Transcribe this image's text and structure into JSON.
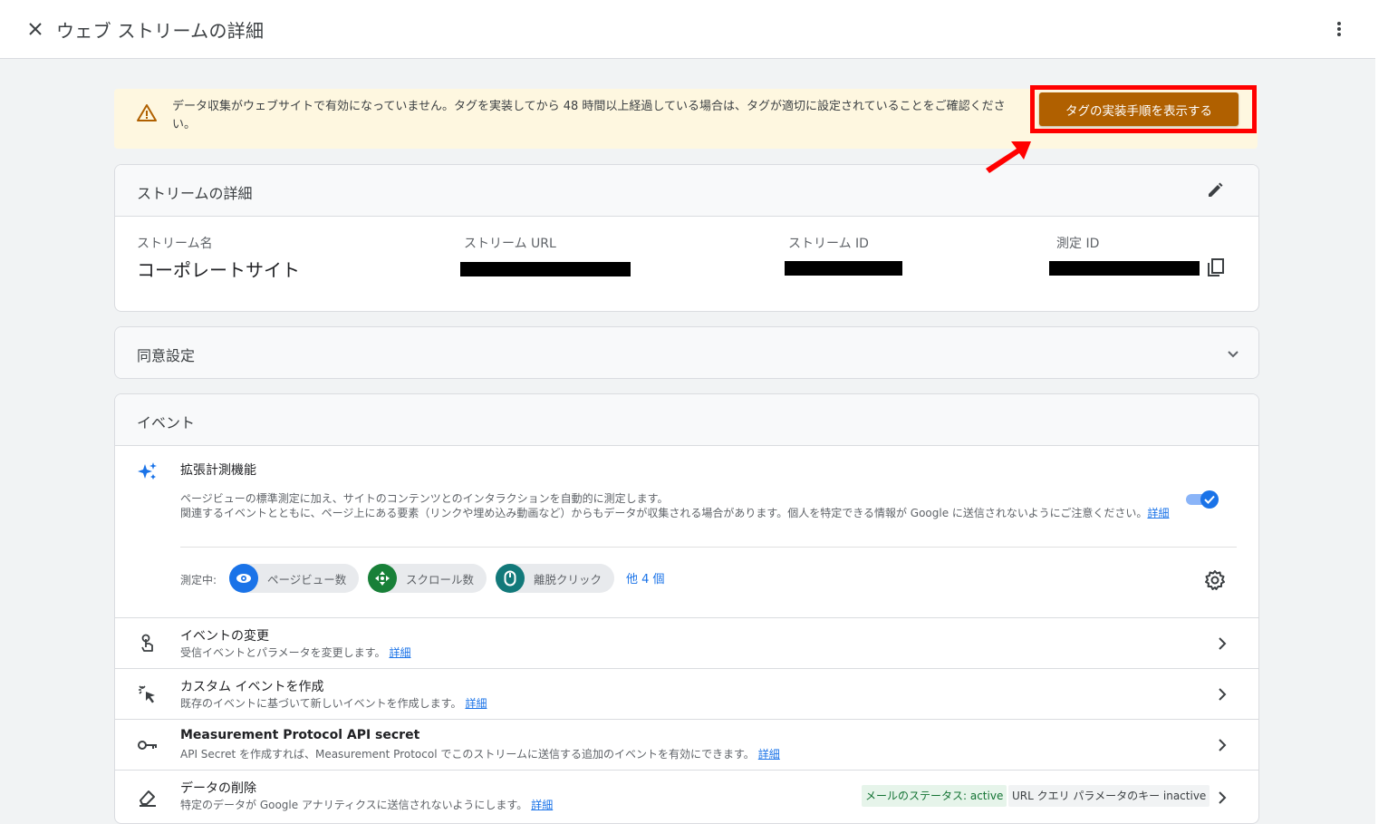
{
  "header": {
    "title": "ウェブ ストリームの詳細"
  },
  "banner": {
    "message": "データ収集がウェブサイトで有効になっていません。タグを実装してから 48 時間以上経過している場合は、タグが適切に設定されていることをご確認ください。",
    "button_label": "タグの実装手順を表示する",
    "accent_color": "#b06000",
    "annotation_color": "#ff0000"
  },
  "stream_details": {
    "title": "ストリームの詳細",
    "name_label": "ストリーム名",
    "name_value": "コーポレートサイト",
    "url_label": "ストリーム URL",
    "id_label": "ストリーム ID",
    "measurement_id_label": "測定 ID"
  },
  "consent": {
    "title": "同意設定"
  },
  "events": {
    "title": "イベント",
    "enhanced": {
      "title": "拡張計測機能",
      "desc_line1": "ページビューの標準測定に加え、サイトのコンテンツとのインタラクションを自動的に測定します。",
      "desc_line2": "関連するイベントとともに、ページ上にある要素（リンクや埋め込み動画など）からもデータが収集される場合があります。個人を特定できる情報が Google に送信されないようにご注意ください。",
      "desc_link": "詳細",
      "toggle_on": true,
      "measuring_label": "測定中:",
      "chips": [
        {
          "label": "ページビュー数",
          "icon": "eye-icon",
          "color": "#1a73e8"
        },
        {
          "label": "スクロール数",
          "icon": "scroll-icon",
          "color": "#188038"
        },
        {
          "label": "離脱クリック",
          "icon": "mouse-icon",
          "color": "#12797a"
        }
      ],
      "more_label": "他 4 個"
    },
    "rows": [
      {
        "title": "イベントの変更",
        "desc": "受信イベントとパラメータを変更します。",
        "link": "詳細",
        "icon": "touch-icon"
      },
      {
        "title": "カスタム イベントを作成",
        "desc": "既存のイベントに基づいて新しいイベントを作成します。",
        "link": "詳細",
        "icon": "sparkle-click-icon"
      },
      {
        "title": "Measurement Protocol API secret",
        "desc": "API Secret を作成すれば、Measurement Protocol でこのストリームに送信する追加のイベントを有効にできます。",
        "link": "詳細",
        "icon": "key-icon"
      },
      {
        "title": "データの削除",
        "desc": "特定のデータが Google アナリティクスに送信されないようにします。",
        "link": "詳細",
        "icon": "eraser-icon",
        "status_active": "メールのステータス: active",
        "status_inactive": "URL クエリ パラメータのキー inactive"
      }
    ]
  }
}
